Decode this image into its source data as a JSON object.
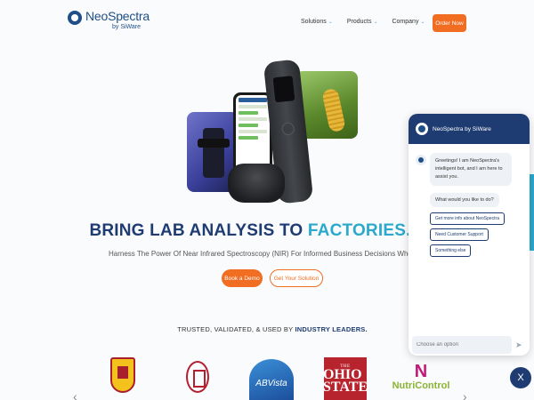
{
  "brand": {
    "name": "NeoSpectra",
    "sub": "by SiWare"
  },
  "nav": {
    "items": [
      "Solutions",
      "Products",
      "Company"
    ],
    "order_label": "Order Now"
  },
  "hero": {
    "headline_main": "BRING LAB ANALYSIS TO ",
    "headline_accent": "FACTORIES.",
    "subtext": "Harness The Power Of Near Infrared Spectroscopy (NIR) For Informed Business Decisions When & Where You Need",
    "demo_label": "Book a Demo",
    "solution_label": "Get Your Solution"
  },
  "trusted": {
    "prefix": "TRUSTED, VALIDATED, & USED BY ",
    "bold": "INDUSTRY LEADERS."
  },
  "logos": {
    "abvista": "ABVista",
    "ohio_top": "THE",
    "ohio_main": "OHIO STATE",
    "nutri_n": "N",
    "nutri_word": "NutriControl"
  },
  "chat": {
    "title": "NeoSpectra by SiWare",
    "greeting": "Greetings! I am NeoSpectra's intelligent bot, and I am here to assist you.",
    "question": "What would you like to do?",
    "options": [
      "Get more info about NeoSpectra",
      "Need Customer Support",
      "Something else"
    ],
    "placeholder": "Choose an option",
    "close": "X"
  },
  "colors": {
    "brand_navy": "#1f3c72",
    "accent_orange": "#f06d22",
    "accent_teal": "#2aa9cc"
  }
}
